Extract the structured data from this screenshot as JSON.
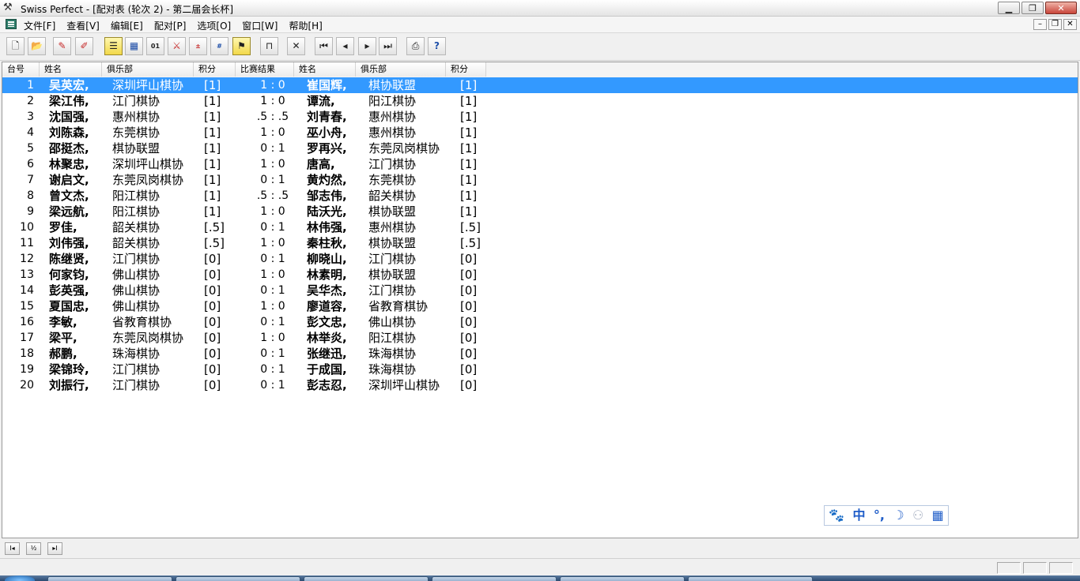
{
  "window": {
    "title": "Swiss Perfect - [配对表  (轮次 2) - 第二届会长杯]"
  },
  "menu": {
    "items": [
      "文件[F]",
      "查看[V]",
      "编辑[E]",
      "配对[P]",
      "选项[O]",
      "窗口[W]",
      "帮助[H]"
    ]
  },
  "toolbar": {
    "icons": [
      "new-tournament-icon",
      "open-tournament-icon",
      "pen-icon",
      "pen-edit-icon",
      "player-list-icon",
      "grid-view-icon",
      "binary-result-icon",
      "cross-table-icon",
      "rating-2285-icon",
      "rating-1236-icon",
      "flag-icon",
      "table-icon",
      "cross-icon",
      "first-round-icon",
      "prev-round-icon",
      "next-round-icon",
      "last-round-icon",
      "print-icon",
      "help-icon"
    ]
  },
  "table": {
    "headers": {
      "board": "台号",
      "name1": "姓名",
      "club1": "俱乐部",
      "pts1": "积分",
      "result": "比赛结果",
      "name2": "姓名",
      "club2": "俱乐部",
      "pts2": "积分"
    },
    "rows": [
      {
        "board": "1",
        "name1": "吴英宏,",
        "club1": "深圳坪山棋协",
        "pts1": "[1]",
        "result": "1  :  0",
        "name2": "崔国辉,",
        "club2": "棋协联盟",
        "pts2": "[1]"
      },
      {
        "board": "2",
        "name1": "梁江伟,",
        "club1": "江门棋协",
        "pts1": "[1]",
        "result": "1  :  0",
        "name2": "谭流,",
        "club2": "阳江棋协",
        "pts2": "[1]"
      },
      {
        "board": "3",
        "name1": "沈国强,",
        "club1": "惠州棋协",
        "pts1": "[1]",
        "result": ".5  :  .5",
        "name2": "刘青春,",
        "club2": "惠州棋协",
        "pts2": "[1]"
      },
      {
        "board": "4",
        "name1": "刘陈森,",
        "club1": "东莞棋协",
        "pts1": "[1]",
        "result": "1  :  0",
        "name2": "巫小舟,",
        "club2": "惠州棋协",
        "pts2": "[1]"
      },
      {
        "board": "5",
        "name1": "邵挺杰,",
        "club1": "棋协联盟",
        "pts1": "[1]",
        "result": "0  :  1",
        "name2": "罗再兴,",
        "club2": "东莞凤岗棋协",
        "pts2": "[1]"
      },
      {
        "board": "6",
        "name1": "林聚忠,",
        "club1": "深圳坪山棋协",
        "pts1": "[1]",
        "result": "1  :  0",
        "name2": "唐高,",
        "club2": "江门棋协",
        "pts2": "[1]"
      },
      {
        "board": "7",
        "name1": "谢启文,",
        "club1": "东莞凤岗棋协",
        "pts1": "[1]",
        "result": "0  :  1",
        "name2": "黄灼然,",
        "club2": "东莞棋协",
        "pts2": "[1]"
      },
      {
        "board": "8",
        "name1": "曾文杰,",
        "club1": "阳江棋协",
        "pts1": "[1]",
        "result": ".5  :  .5",
        "name2": "邹志伟,",
        "club2": "韶关棋协",
        "pts2": "[1]"
      },
      {
        "board": "9",
        "name1": "梁远航,",
        "club1": "阳江棋协",
        "pts1": "[1]",
        "result": "1  :  0",
        "name2": "陆沃光,",
        "club2": "棋协联盟",
        "pts2": "[1]"
      },
      {
        "board": "10",
        "name1": "罗佳,",
        "club1": "韶关棋协",
        "pts1": "[.5]",
        "result": "0  :  1",
        "name2": "林伟强,",
        "club2": "惠州棋协",
        "pts2": "[.5]"
      },
      {
        "board": "11",
        "name1": "刘伟强,",
        "club1": "韶关棋协",
        "pts1": "[.5]",
        "result": "1  :  0",
        "name2": "秦柱秋,",
        "club2": "棋协联盟",
        "pts2": "[.5]"
      },
      {
        "board": "12",
        "name1": "陈继贤,",
        "club1": "江门棋协",
        "pts1": "[0]",
        "result": "0  :  1",
        "name2": "柳晓山,",
        "club2": "江门棋协",
        "pts2": "[0]"
      },
      {
        "board": "13",
        "name1": "何家钧,",
        "club1": "佛山棋协",
        "pts1": "[0]",
        "result": "1  :  0",
        "name2": "林素明,",
        "club2": "棋协联盟",
        "pts2": "[0]"
      },
      {
        "board": "14",
        "name1": "彭英强,",
        "club1": "佛山棋协",
        "pts1": "[0]",
        "result": "0  :  1",
        "name2": "吴华杰,",
        "club2": "江门棋协",
        "pts2": "[0]"
      },
      {
        "board": "15",
        "name1": "夏国忠,",
        "club1": "佛山棋协",
        "pts1": "[0]",
        "result": "1  :  0",
        "name2": "廖道容,",
        "club2": "省教育棋协",
        "pts2": "[0]"
      },
      {
        "board": "16",
        "name1": "李敏,",
        "club1": "省教育棋协",
        "pts1": "[0]",
        "result": "0  :  1",
        "name2": "彭文忠,",
        "club2": "佛山棋协",
        "pts2": "[0]"
      },
      {
        "board": "17",
        "name1": "梁平,",
        "club1": "东莞凤岗棋协",
        "pts1": "[0]",
        "result": "1  :  0",
        "name2": "林举炎,",
        "club2": "阳江棋协",
        "pts2": "[0]"
      },
      {
        "board": "18",
        "name1": "郝鹏,",
        "club1": "珠海棋协",
        "pts1": "[0]",
        "result": "0  :  1",
        "name2": "张继迅,",
        "club2": "珠海棋协",
        "pts2": "[0]"
      },
      {
        "board": "19",
        "name1": "梁锦玲,",
        "club1": "江门棋协",
        "pts1": "[0]",
        "result": "0  :  1",
        "name2": "于成国,",
        "club2": "珠海棋协",
        "pts2": "[0]"
      },
      {
        "board": "20",
        "name1": "刘振行,",
        "club1": "江门棋协",
        "pts1": "[0]",
        "result": "0  :  1",
        "name2": "彭志忍,",
        "club2": "深圳坪山棋协",
        "pts2": "[0]"
      }
    ],
    "selected_row": 0,
    "selection_color": "#3399ff"
  },
  "ime": {
    "mode": "中",
    "punct": "°,",
    "icons": [
      "paw-icon",
      "moon-icon",
      "user-icon",
      "grid-icon"
    ]
  },
  "bottom_tabs": [
    "I◂",
    "½",
    "▸I"
  ]
}
